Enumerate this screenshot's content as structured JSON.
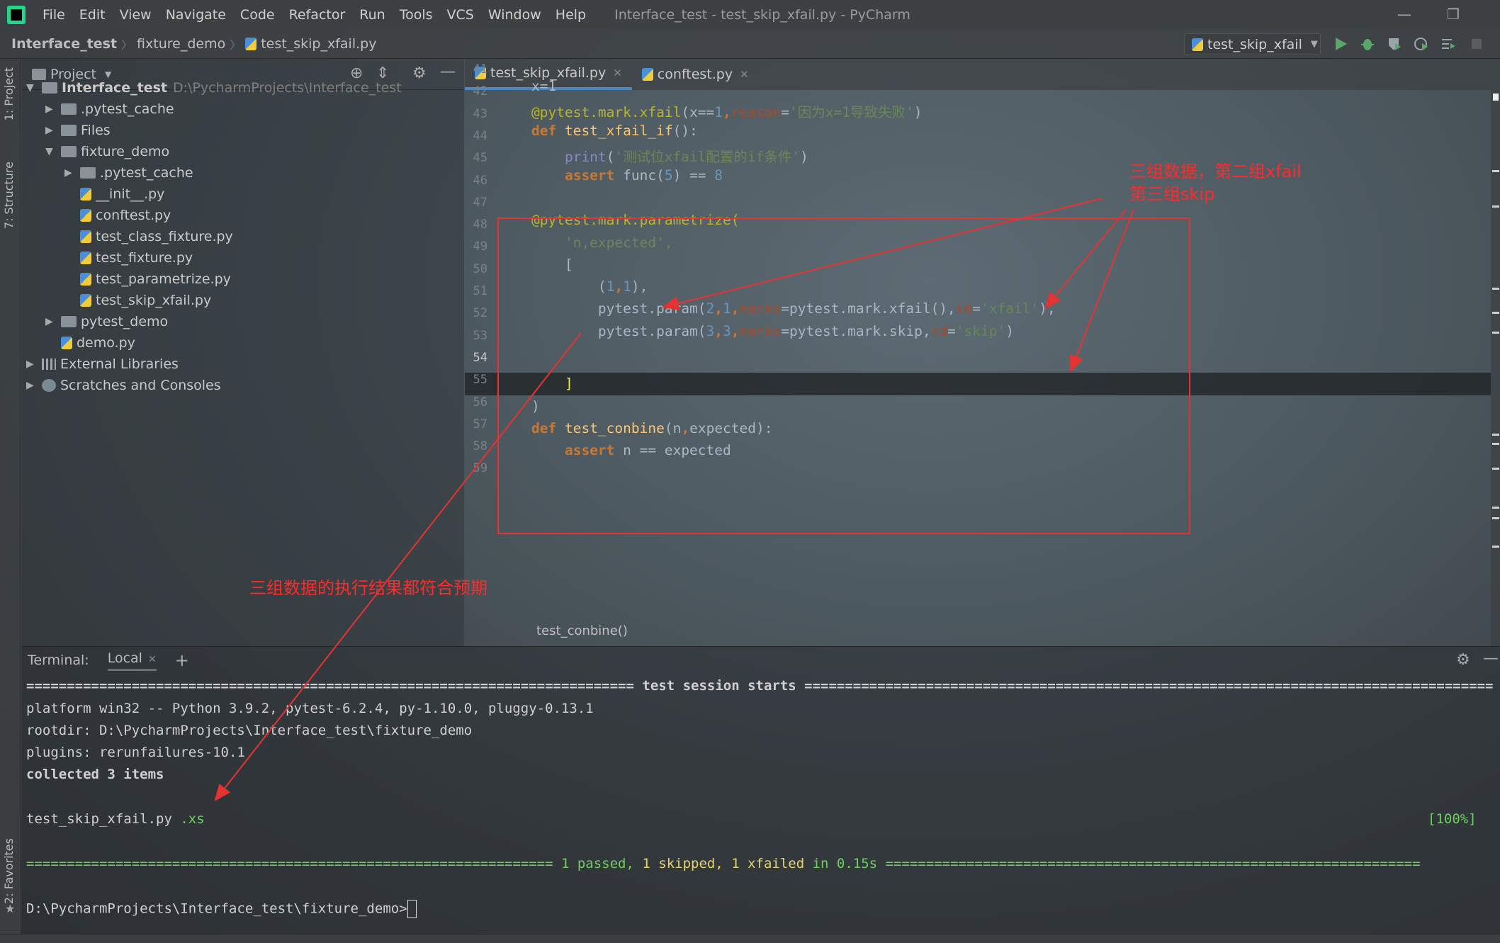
{
  "app": {
    "menu": [
      "File",
      "Edit",
      "View",
      "Navigate",
      "Code",
      "Refactor",
      "Run",
      "Tools",
      "VCS",
      "Window",
      "Help"
    ],
    "title": "Interface_test - test_skip_xfail.py - PyCharm"
  },
  "nav": {
    "crumbs": [
      "Interface_test",
      "fixture_demo",
      "test_skip_xfail.py"
    ],
    "run_config": "test_skip_xfail"
  },
  "tool_tabs": {
    "project": "1: Project",
    "structure": "7: Structure",
    "favorites": "2: Favorites"
  },
  "project": {
    "header": "Project",
    "tree": [
      {
        "label": "Interface_test",
        "path": "D:\\PycharmProjects\\Interface_test",
        "type": "folder",
        "arrow": "▼"
      },
      {
        "label": ".pytest_cache",
        "type": "folder",
        "arrow": "▶"
      },
      {
        "label": "Files",
        "type": "folder",
        "arrow": "▶"
      },
      {
        "label": "fixture_demo",
        "type": "folder",
        "arrow": "▼"
      },
      {
        "label": ".pytest_cache",
        "type": "folder",
        "arrow": "▶"
      },
      {
        "label": "__init__.py",
        "type": "py"
      },
      {
        "label": "conftest.py",
        "type": "py"
      },
      {
        "label": "test_class_fixture.py",
        "type": "py"
      },
      {
        "label": "test_fixture.py",
        "type": "py"
      },
      {
        "label": "test_parametrize.py",
        "type": "py"
      },
      {
        "label": "test_skip_xfail.py",
        "type": "py"
      },
      {
        "label": "pytest_demo",
        "type": "folder",
        "arrow": "▶"
      },
      {
        "label": "demo.py",
        "type": "py"
      },
      {
        "label": "External Libraries",
        "type": "lib",
        "arrow": "▶"
      },
      {
        "label": "Scratches and Consoles",
        "type": "scratch",
        "arrow": "▶"
      }
    ]
  },
  "editor": {
    "tabs": [
      "test_skip_xfail.py",
      "conftest.py"
    ],
    "line_numbers": [
      "41",
      "42",
      "43",
      "44",
      "45",
      "46",
      "47",
      "48",
      "49",
      "50",
      "51",
      "52",
      "53",
      "54",
      "55",
      "56",
      "57",
      "58",
      "59"
    ],
    "lines": {
      "l42": "x=1",
      "l43a": "@pytest.mark.xfail",
      "l43b": "(x==",
      "l43c": "1",
      "l43d": ",",
      "l43e": "reason",
      "l43f": "=",
      "l43g": "'因为x=1导致失败'",
      "l43h": ")",
      "l44a": "def ",
      "l44b": "test_xfail_if",
      "l44c": "():",
      "l45a": "    print",
      "l45b": "(",
      "l45c": "'测试位xfail配置的if条件'",
      "l45d": ")",
      "l46a": "    assert ",
      "l46b": "func(",
      "l46c": "5",
      "l46d": ") == ",
      "l46e": "8",
      "l48": "@pytest.mark.parametrize(",
      "l49": "    'n,expected',",
      "l50": "    [",
      "l51a": "        (",
      "l51b": "1",
      "l51c": ",",
      "l51d": "1",
      "l51e": "),",
      "l52a": "        pytest.param(",
      "l52b": "2",
      "l52c": ",",
      "l52d": "1",
      "l52e": ",",
      "l52f": "marks",
      "l52g": "=pytest.mark.xfail(),",
      "l52h": "id",
      "l52i": "=",
      "l52j": "'xfail'",
      "l52k": "),",
      "l53a": "        pytest.param(",
      "l53b": "3",
      "l53c": ",",
      "l53d": "3",
      "l53e": ",",
      "l53f": "marks",
      "l53g": "=pytest.mark.skip,",
      "l53h": "id",
      "l53i": "=",
      "l53j": "'skip'",
      "l53k": ")",
      "l54": "    ]",
      "l55": ")",
      "l56a": "def ",
      "l56b": "test_conbine",
      "l56c": "(n",
      "l56d": ",",
      "l56e": "expected):",
      "l57a": "    assert ",
      "l57b": "n == expected"
    },
    "breadcrumb_fn": "test_conbine()"
  },
  "annotations": {
    "top_right": "三组数据，第二组xfail\n第三组skip",
    "left": "三组数据的执行结果都符合预期",
    "color": "#e53333"
  },
  "terminal": {
    "label": "Terminal:",
    "tab": "Local",
    "session_title": " test session starts ",
    "platform": "platform win32 -- Python 3.9.2, pytest-6.2.4, py-1.10.0, pluggy-0.13.1",
    "rootdir": "rootdir: D:\\PycharmProjects\\Interface_test\\fixture_demo",
    "plugins": "plugins: rerunfailures-10.1",
    "collected": "collected 3 items",
    "file": "test_skip_xfail.py",
    "file_result": " .xs",
    "percent": "[100%]",
    "summary_passed": " 1 passed,",
    "summary_skipped": " 1 skipped,",
    "summary_xfailed": " 1 xfailed",
    "summary_time": " in 0.15s ",
    "prompt": "D:\\PycharmProjects\\Interface_test\\fixture_demo>"
  },
  "colors": {
    "accent": "#4a88c7",
    "annotation": "#e53333",
    "pass_green": "#6fcf5f"
  }
}
